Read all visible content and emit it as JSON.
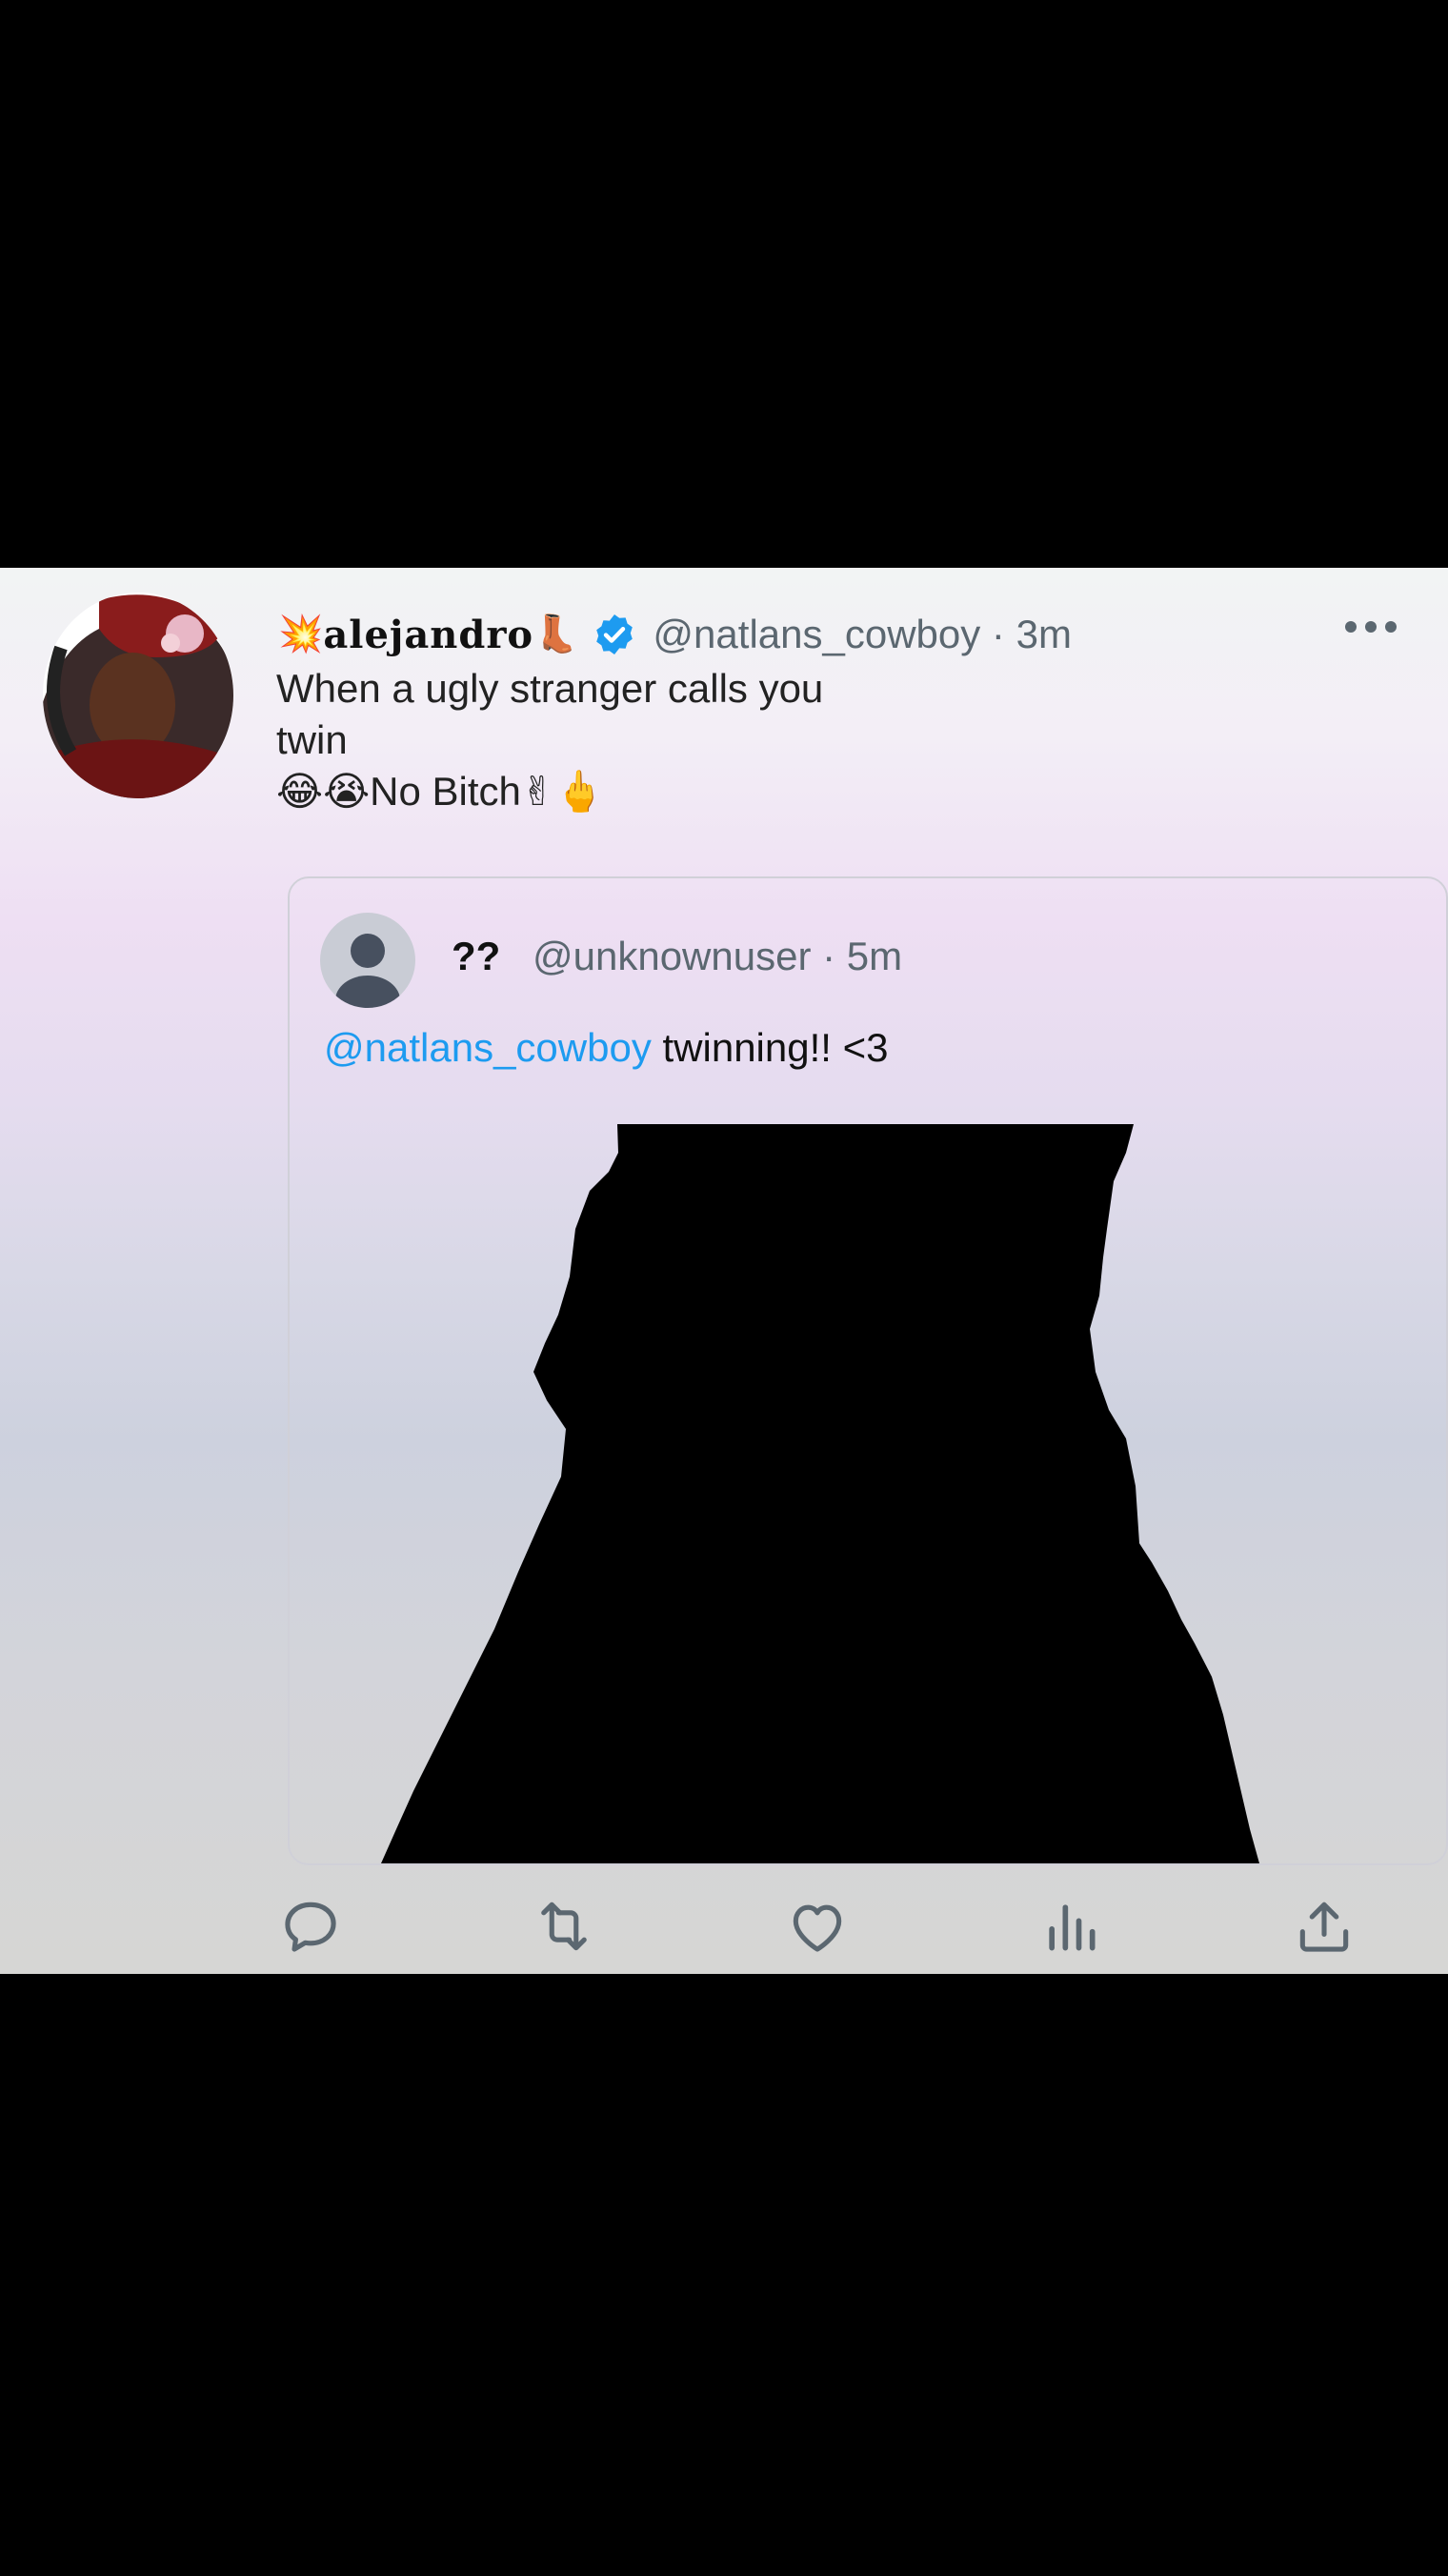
{
  "tweet": {
    "display_name": "alejandro",
    "name_emoji_prefix": "💥",
    "name_emoji_suffix": "👢",
    "handle_time": "@natlans_cowboy · 3m",
    "text_line1": "When a ugly stranger calls you",
    "text_line2": "twin",
    "text_line3_emoji_pre": "😂😭",
    "text_line3": "No Bitch",
    "text_line3_emoji_post": "✌🖕"
  },
  "quoted": {
    "display_name": "??",
    "handle_time": "@unknownuser · 5m",
    "mention": "@natlans_cowboy",
    "text": " twinning!! <3"
  },
  "icons": [
    "avatar",
    "verified-badge-icon",
    "more-icon",
    "reply-icon",
    "retweet-icon",
    "like-icon",
    "views-icon",
    "share-icon"
  ],
  "colors": {
    "accent": "#1d9bf0",
    "handle": "#5b6770",
    "icon": "#5b6770",
    "background": "#000000"
  }
}
